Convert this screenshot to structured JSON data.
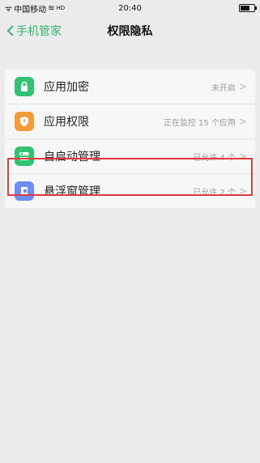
{
  "statusbar": {
    "carrier": "中国移动",
    "signal": "ᯤ",
    "wifi": "≋",
    "volte": "HD",
    "time": "20:40"
  },
  "nav": {
    "back_label": "手机管家",
    "title": "权限隐私"
  },
  "items": [
    {
      "label": "应用加密",
      "status": "未开启",
      "icon_color": "#33c173",
      "icon": "lock-icon"
    },
    {
      "label": "应用权限",
      "status": "正在监控 15 个应用",
      "icon_color": "#f39a3a",
      "icon": "shield-icon"
    },
    {
      "label": "自启动管理",
      "status": "已允许 4 个",
      "icon_color": "#33c173",
      "icon": "toggle-icon"
    },
    {
      "label": "悬浮窗管理",
      "status": "已允许 2 个",
      "icon_color": "#6d8df2",
      "icon": "floating-window-icon"
    }
  ],
  "highlight_color": "#e0393e"
}
